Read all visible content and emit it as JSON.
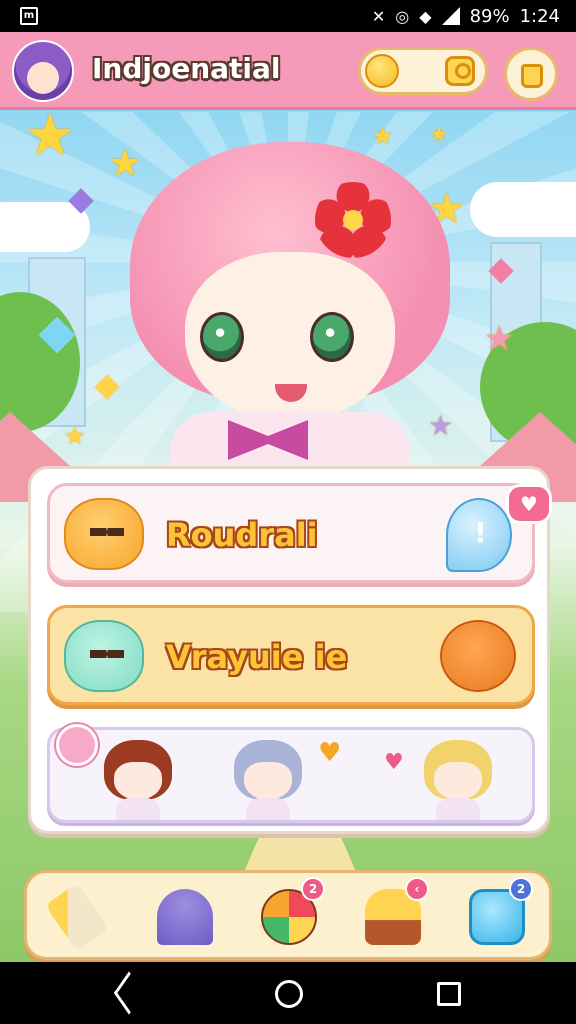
{
  "status_bar": {
    "battery_text": "89%",
    "time": "1:24",
    "left_icon": "app-notification-icon",
    "icons": [
      "bluetooth-muted-icon",
      "do-not-disturb-icon",
      "wifi-icon",
      "signal-icon"
    ]
  },
  "header": {
    "app_title": "Indjoenatial",
    "avatar_icon": "purple-hair-avatar",
    "currency_icons": [
      "coin-icon",
      "profile-badge-icon"
    ],
    "shop_icon": "shopping-bag-icon"
  },
  "hero": {
    "character": "pink-hair-chibi-girl",
    "accent_icons": [
      "flower-hairclip-icon",
      "star-icon",
      "gem-icon"
    ]
  },
  "menu": {
    "card_1": {
      "label": "Roudrali",
      "left_icon": "orange-cat-icon",
      "right_icon": "speech-bubble-icon"
    },
    "card_2": {
      "label": "Vrayuie ie",
      "left_icon": "mint-blob-icon",
      "right_icon": "puppy-icon"
    },
    "characters": [
      {
        "name": "brown-hair-chibi",
        "accent": "ribbon-badge-icon"
      },
      {
        "name": "silver-hair-chibi",
        "accent": "heart-icon"
      },
      {
        "name": "blonde-hair-chibi",
        "accent": "heart-balloon-icon"
      }
    ]
  },
  "dock": {
    "items": [
      {
        "icon": "wand-icon"
      },
      {
        "icon": "jellyfish-icon"
      },
      {
        "icon": "color-ball-icon",
        "badge": "2"
      },
      {
        "icon": "cake-icon",
        "badge": "‹"
      },
      {
        "icon": "home-icon",
        "badge": "2"
      }
    ]
  },
  "colors": {
    "header_pink": "#f59ab8",
    "label_gold": "#fbc436",
    "label_outline": "#a8461a",
    "dock_cream": "#fdf0cf"
  }
}
